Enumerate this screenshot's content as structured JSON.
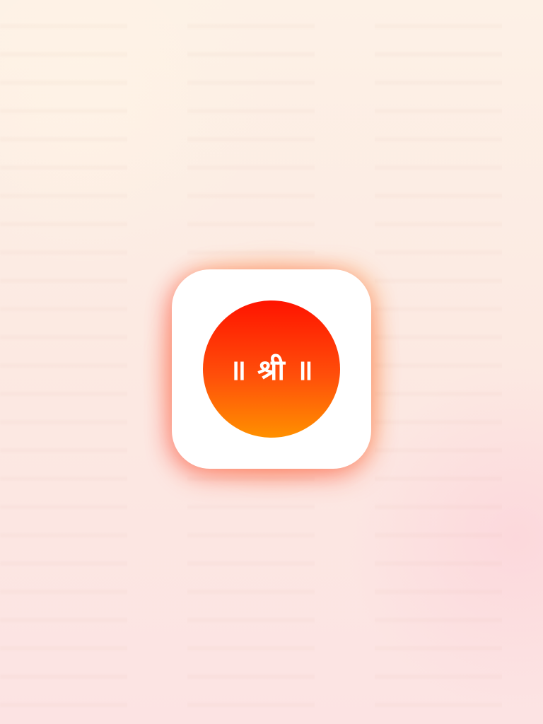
{
  "app_icon": {
    "emblem_text": "॥ श्री ॥",
    "colors": {
      "tile_background": "#ffffff",
      "medallion_top": "#ff1400",
      "medallion_bottom": "#ff9000",
      "emblem_text": "#ffffff"
    }
  },
  "background": {
    "colors": {
      "top": "#fdf1e6",
      "bottom": "#fce3e3"
    }
  }
}
